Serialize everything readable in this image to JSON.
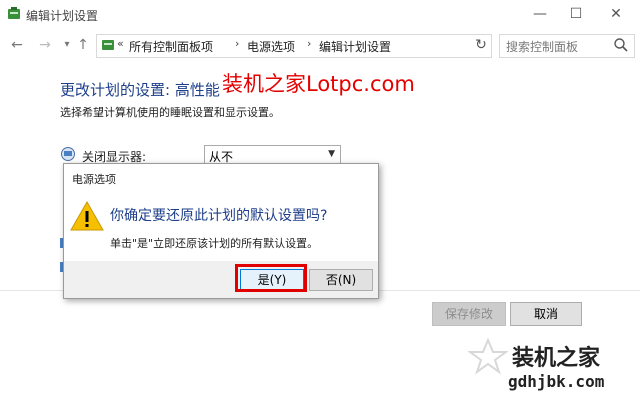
{
  "window": {
    "title": "编辑计划设置"
  },
  "address_bar": {
    "prefix": "«",
    "crumbs": [
      "所有控制面板项",
      "电源选项",
      "编辑计划设置"
    ]
  },
  "search": {
    "placeholder": "搜索控制面板"
  },
  "main": {
    "plan_title": "更改计划的设置: 高性能",
    "plan_desc": "选择希望计算机使用的睡眠设置和显示设置。",
    "display_label": "关闭显示器:",
    "display_value": "从不"
  },
  "buttons": {
    "save": "保存修改",
    "cancel": "取消"
  },
  "dialog": {
    "title": "电源选项",
    "question": "你确定要还原此计划的默认设置吗?",
    "detail": "单击\"是\"立即还原该计划的所有默认设置。",
    "yes": "是(Y)",
    "no": "否(N)"
  },
  "watermarks": {
    "top": "装机之家Lotpc.com",
    "brand": "装机之家",
    "domain": "gdhjbk.com"
  },
  "colors": {
    "accent": "#1e3f8a",
    "highlight_box": "#e00000",
    "watermark_red": "#e50000"
  },
  "icons": {
    "app": "power-options-icon",
    "warning": "warning-icon",
    "monitor": "monitor-icon"
  }
}
